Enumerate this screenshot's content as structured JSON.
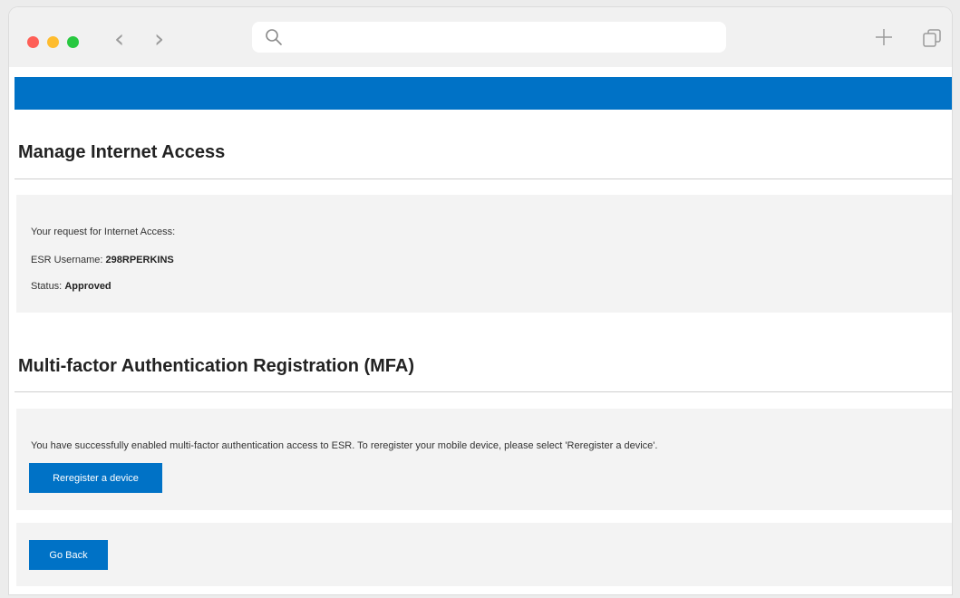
{
  "browser": {
    "address_placeholder": "",
    "address_value": ""
  },
  "page": {
    "title": "Manage Internet Access",
    "request": {
      "intro": "Your request for Internet Access:",
      "username_label": "ESR Username:",
      "username_value": "298RPERKINS",
      "status_label": "Status:",
      "status_value": "Approved"
    },
    "mfa": {
      "title": "Multi-factor Authentication Registration (MFA)",
      "message": "You have successfully enabled multi-factor authentication access to ESR. To reregister your mobile device, please select 'Reregister a device'.",
      "reregister_label": "Reregister a device"
    },
    "go_back_label": "Go Back"
  },
  "colors": {
    "brand_blue": "#0072c6",
    "panel_bg": "#f3f3f3"
  },
  "icons": [
    "search-icon",
    "back-arrow-icon",
    "forward-arrow-icon",
    "new-tab-plus-icon",
    "tabs-overview-icon"
  ]
}
